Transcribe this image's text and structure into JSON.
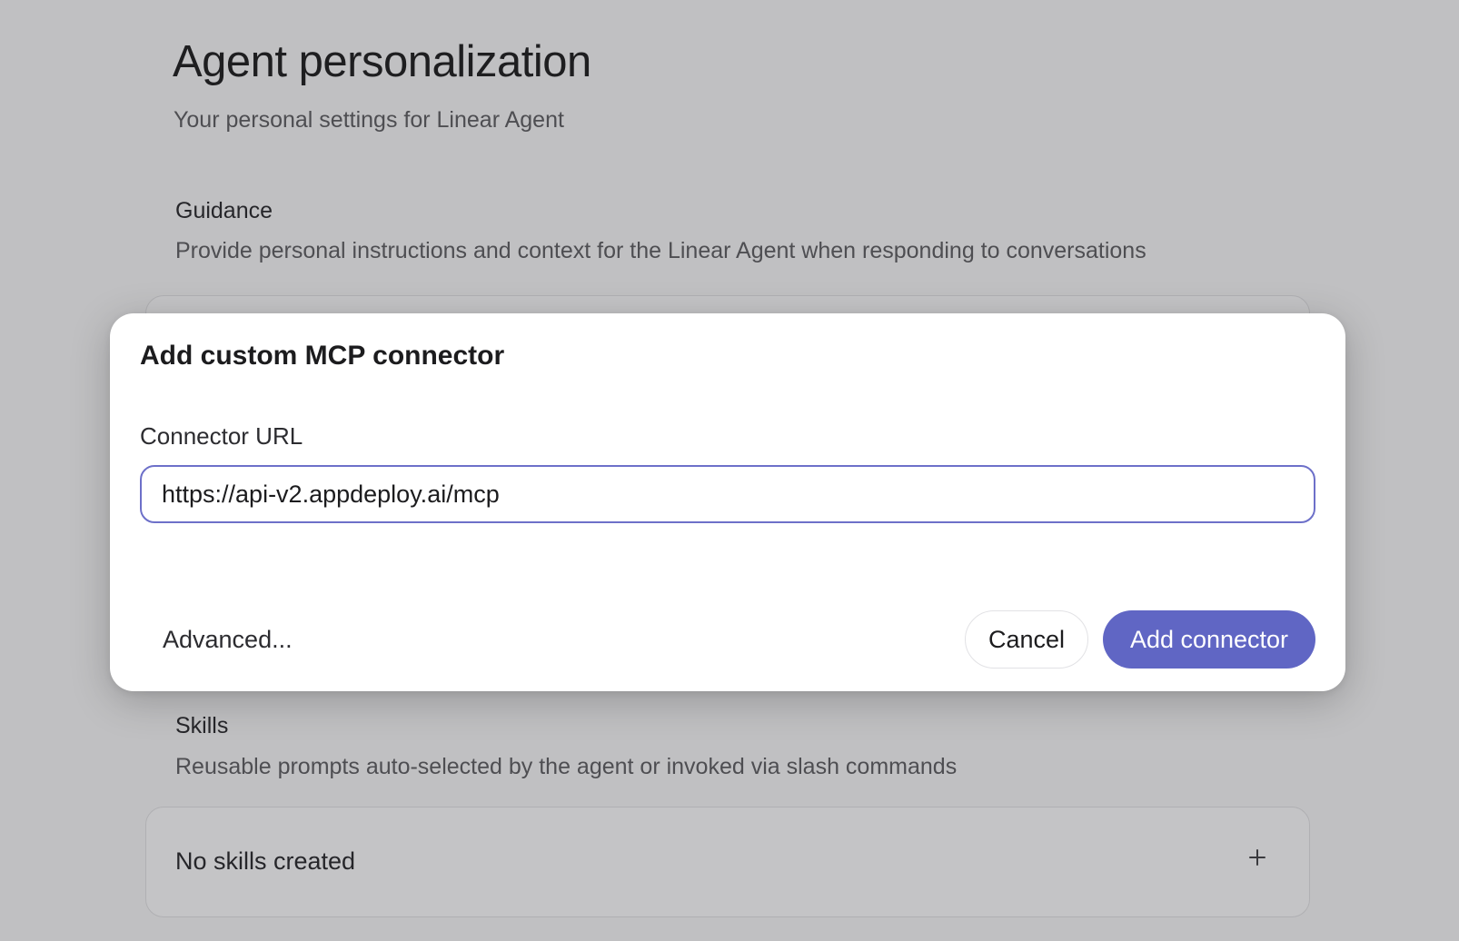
{
  "page": {
    "title": "Agent personalization",
    "subtitle": "Your personal settings for Linear Agent"
  },
  "guidance": {
    "title": "Guidance",
    "description": "Provide personal instructions and context for the Linear Agent when responding to conversations"
  },
  "skills": {
    "title": "Skills",
    "description": "Reusable prompts auto-selected by the agent or invoked via slash commands",
    "empty_state": "No skills created",
    "add_icon": "plus-icon"
  },
  "modal": {
    "title": "Add custom MCP connector",
    "url_label": "Connector URL",
    "url_value": "https://api-v2.appdeploy.ai/mcp",
    "advanced_label": "Advanced...",
    "cancel_label": "Cancel",
    "submit_label": "Add connector"
  },
  "colors": {
    "backdrop": "#c0c0c2",
    "accent": "#6066c4",
    "input_focus_border": "#6d70c9",
    "modal_background": "#ffffff"
  }
}
